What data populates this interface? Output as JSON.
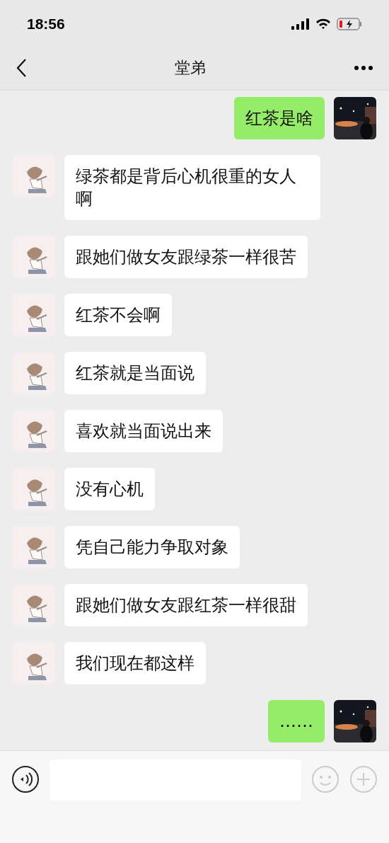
{
  "status_bar": {
    "time": "18:56"
  },
  "header": {
    "title": "堂弟"
  },
  "messages": [
    {
      "kind": "self",
      "text": "红茶是啥"
    },
    {
      "kind": "other",
      "text": "绿茶都是背后心机很重的女人啊"
    },
    {
      "kind": "other",
      "text": "跟她们做女友跟绿茶一样很苦"
    },
    {
      "kind": "other",
      "text": "红茶不会啊"
    },
    {
      "kind": "other",
      "text": "红茶就是当面说"
    },
    {
      "kind": "other",
      "text": "喜欢就当面说出来"
    },
    {
      "kind": "other",
      "text": "没有心机"
    },
    {
      "kind": "other",
      "text": "凭自己能力争取对象"
    },
    {
      "kind": "other",
      "text": "跟她们做女友跟红茶一样很甜"
    },
    {
      "kind": "other",
      "text": "我们现在都这样"
    },
    {
      "kind": "self",
      "text": "……"
    }
  ]
}
